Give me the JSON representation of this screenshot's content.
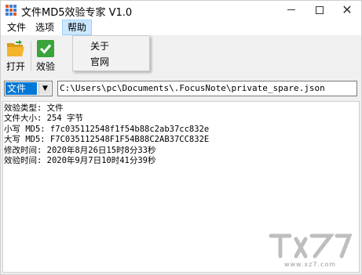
{
  "window": {
    "title": "文件MD5效验专家 V1.0",
    "controls": {
      "minimize": "minimize",
      "maximize": "maximize",
      "close": "✕"
    }
  },
  "menu": {
    "file": "文件",
    "options": "选项",
    "help": "帮助",
    "help_items": [
      "关于",
      "官网"
    ]
  },
  "toolbar": {
    "open_label": "打开",
    "verify_label": "效验",
    "open_icon": "folder-open-icon",
    "verify_icon": "checkmark-icon"
  },
  "input": {
    "type_value": "文件",
    "path_value": "C:\\Users\\pc\\Documents\\.FocusNote\\private_spare.json"
  },
  "output": {
    "lines": [
      "效验类型: 文件",
      "文件大小: 254 字节",
      "小写 MD5: f7c035112548f1f54b88c2ab37cc832e",
      "大写 MD5: F7C035112548F1F54B88C2AB37CC832E",
      "修改时间: 2020年8月26日15时8分33秒",
      "效验时间: 2020年9月7日10时41分39秒"
    ]
  },
  "watermark": {
    "text": "www.xz7.com"
  },
  "colors": {
    "accent": "#0078d7",
    "menu_highlight": "#cce8ff",
    "check_green": "#3aa43a",
    "folder_yellow": "#f2b52b"
  }
}
